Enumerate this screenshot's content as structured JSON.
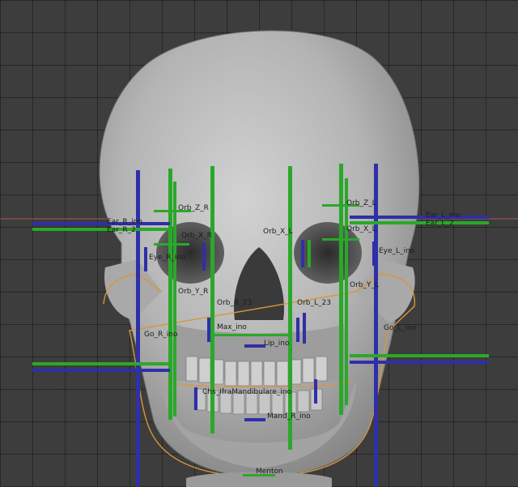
{
  "viewport": {
    "background": "#3d3d3d",
    "grid_color": "#2b2b2b",
    "horizon_color": "#a85a4a"
  },
  "model": {
    "name": "skull-mesh",
    "bone_color": "#b9b9b9",
    "outline_color": "#d9963c"
  },
  "colors": {
    "blue_empty": "#2f2fa8",
    "green_empty": "#2aa82a"
  },
  "labels": {
    "ear_r_ino": "Ear_R_ino",
    "ear_r_2": "Ear_R_2",
    "ear_l_ino": "Ear_L_ino",
    "ear_l_2": "Ear_L_2",
    "orb_z_r": "Orb_Z_R",
    "orb_x_r": "Orb_X_R",
    "orb_x_l": "Orb_X_L",
    "orb_z_l": "Orb_Z_L",
    "orb_x_l2": "Orb_X_L",
    "eye_r_ino": "Eye_R_ino",
    "eye_l_ino": "Eye_L_ino",
    "orb_y_r": "Orb_Y_R",
    "orb_y_l": "Orb_Y_L",
    "orb_r_23": "Orb_R_23",
    "orb_l_23": "Orb_L_23",
    "go_r_ino": "Go_R_ino",
    "go_l_ino": "Go_L_ino",
    "max_ino": "Max_ino",
    "lip_ino": "Lip_ino",
    "chs_ifra": "Chs_IfraMandibulare_ino",
    "mand_ino": "Mand_R_ino",
    "menton": "Menton"
  }
}
